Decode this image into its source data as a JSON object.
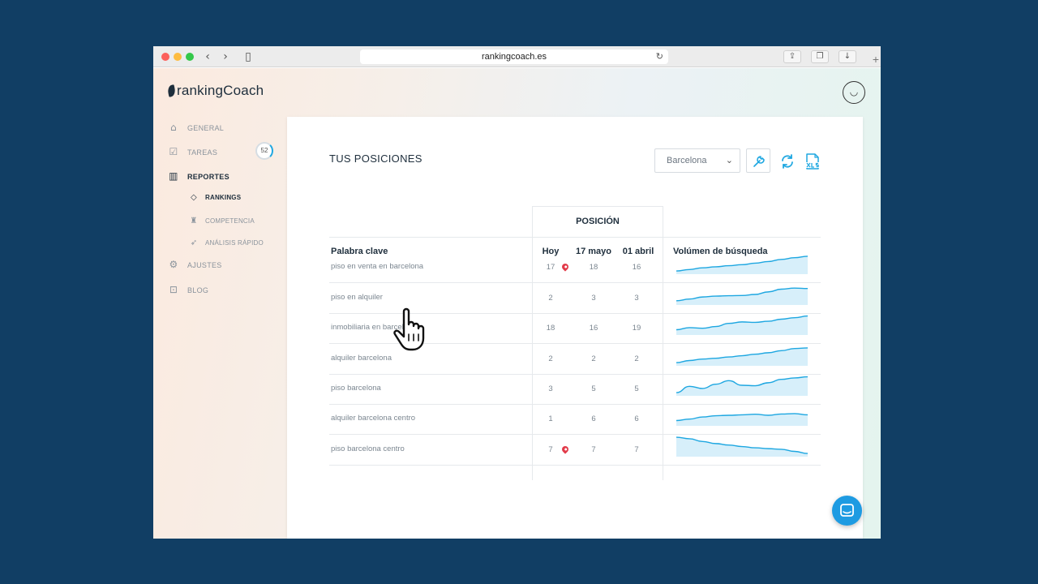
{
  "browser": {
    "url": "rankingcoach.es"
  },
  "brand": {
    "name": "rankingCoach"
  },
  "sidebar": {
    "items": [
      {
        "label": "GENERAL",
        "icon": "home-icon"
      },
      {
        "label": "TAREAS",
        "icon": "checklist-icon",
        "badge": "52"
      },
      {
        "label": "REPORTES",
        "icon": "bar-chart-icon"
      },
      {
        "label": "AJUSTES",
        "icon": "gear-icon"
      },
      {
        "label": "BLOG",
        "icon": "book-icon"
      }
    ],
    "subitems": [
      {
        "label": "RANKINGS",
        "icon": "tag-icon"
      },
      {
        "label": "COMPETENCIA",
        "icon": "trophy-icon"
      },
      {
        "label": "ANÁLISIS RÁPIDO",
        "icon": "rocket-icon"
      }
    ]
  },
  "main": {
    "title": "TUS POSICIONES",
    "location_select": "Barcelona",
    "table": {
      "group_header": "POSICIÓN",
      "columns": [
        "Palabra clave",
        "Hoy",
        "17 mayo",
        "01 abril",
        "Volúmen de búsqueda"
      ],
      "rows": [
        {
          "keyword": "piso en venta en barcelona",
          "hoy": "17",
          "mayo": "18",
          "abril": "16",
          "local": true,
          "volume": [
            0.15,
            0.22,
            0.3,
            0.35,
            0.4,
            0.45,
            0.52,
            0.6,
            0.7,
            0.78,
            0.85
          ]
        },
        {
          "keyword": "piso en alquiler",
          "hoy": "2",
          "mayo": "3",
          "abril": "3",
          "local": false,
          "volume": [
            0.2,
            0.28,
            0.38,
            0.42,
            0.44,
            0.45,
            0.5,
            0.62,
            0.75,
            0.8,
            0.78
          ]
        },
        {
          "keyword": "inmobiliaria en barcelona",
          "hoy": "18",
          "mayo": "16",
          "abril": "19",
          "local": false,
          "volume": [
            0.25,
            0.35,
            0.32,
            0.4,
            0.55,
            0.62,
            0.6,
            0.65,
            0.75,
            0.82,
            0.9
          ]
        },
        {
          "keyword": "alquiler barcelona",
          "hoy": "2",
          "mayo": "2",
          "abril": "2",
          "local": false,
          "volume": [
            0.15,
            0.25,
            0.32,
            0.36,
            0.42,
            0.48,
            0.55,
            0.62,
            0.72,
            0.82,
            0.85
          ]
        },
        {
          "keyword": "piso barcelona",
          "hoy": "3",
          "mayo": "5",
          "abril": "5",
          "local": false,
          "volume": [
            0.15,
            0.45,
            0.35,
            0.55,
            0.72,
            0.5,
            0.48,
            0.62,
            0.78,
            0.85,
            0.9
          ]
        },
        {
          "keyword": "alquiler barcelona centro",
          "hoy": "1",
          "mayo": "6",
          "abril": "6",
          "local": false,
          "volume": [
            0.25,
            0.32,
            0.42,
            0.48,
            0.5,
            0.52,
            0.55,
            0.5,
            0.56,
            0.58,
            0.52
          ]
        },
        {
          "keyword": "piso barcelona centro",
          "hoy": "7",
          "mayo": "7",
          "abril": "7",
          "local": true,
          "volume": [
            0.92,
            0.85,
            0.72,
            0.62,
            0.55,
            0.48,
            0.42,
            0.38,
            0.35,
            0.25,
            0.15
          ]
        }
      ]
    }
  },
  "colors": {
    "accent": "#1ea7e1",
    "spark_fill": "#d7effa",
    "pin": "#e23b4a",
    "background": "#113e64"
  }
}
